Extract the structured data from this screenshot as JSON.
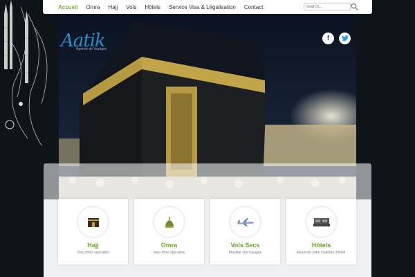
{
  "nav": {
    "items": [
      {
        "label": "Accueil",
        "active": true
      },
      {
        "label": "Omra"
      },
      {
        "label": "Hajj"
      },
      {
        "label": "Vols"
      },
      {
        "label": "Hôtels"
      },
      {
        "label": "Service Visa & Légalisation"
      },
      {
        "label": "Contact"
      }
    ],
    "search_placeholder": "search..."
  },
  "logo": {
    "name": "Aatik",
    "tagline": "Agence de Voyages"
  },
  "social": {
    "facebook": "f",
    "twitter": "t"
  },
  "cards": [
    {
      "title": "Hajj",
      "subtitle": "Nos offres speciales",
      "icon": "kaaba-icon"
    },
    {
      "title": "Omra",
      "subtitle": "Nos offres speciales",
      "icon": "mosque-icon"
    },
    {
      "title": "Vols Secs",
      "subtitle": "Planifier vos voyages",
      "icon": "airplane-icon"
    },
    {
      "title": "Hôtels",
      "subtitle": "Reserver votre chambre d'hôtel",
      "icon": "bed-icon"
    }
  ],
  "colors": {
    "accent": "#7bb32e",
    "logo": "#2d8cc9",
    "background": "#0e1419"
  }
}
